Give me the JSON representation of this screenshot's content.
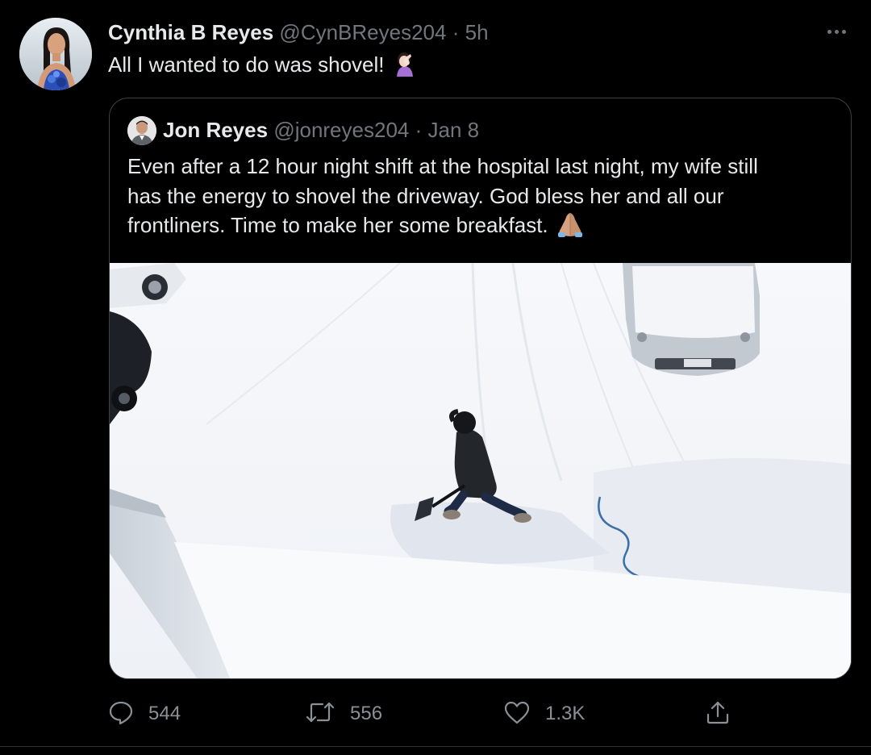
{
  "tweet": {
    "author_name": "Cynthia B Reyes",
    "author_handle": "@CynBReyes204",
    "separator": "·",
    "time": "5h",
    "text": "All I wanted to do was shovel!",
    "emoji": "woman-facepalming-emoji",
    "more_icon": "more-horizontal-icon"
  },
  "quoted": {
    "author_name": "Jon Reyes",
    "author_handle": "@jonreyes204",
    "separator": "·",
    "date": "Jan 8",
    "text_lines": [
      "Even after a 12 hour night shift at the hospital last night, my wife still",
      "has the energy to shovel the driveway. God bless her and all our",
      "frontliners. Time to make her some breakfast."
    ],
    "emoji": "folded-hands-emoji",
    "media": "photo of a woman shoveling a snowy driveway beside parked cars"
  },
  "actions": {
    "reply": {
      "icon": "reply-icon",
      "count": "544"
    },
    "retweet": {
      "icon": "retweet-icon",
      "count": "556"
    },
    "like": {
      "icon": "like-icon",
      "count": "1.3K"
    },
    "share": {
      "icon": "share-icon"
    }
  },
  "colors": {
    "background": "#000000",
    "text_primary": "#e7e9ea",
    "text_muted": "#71767b",
    "border": "#3e4144"
  }
}
